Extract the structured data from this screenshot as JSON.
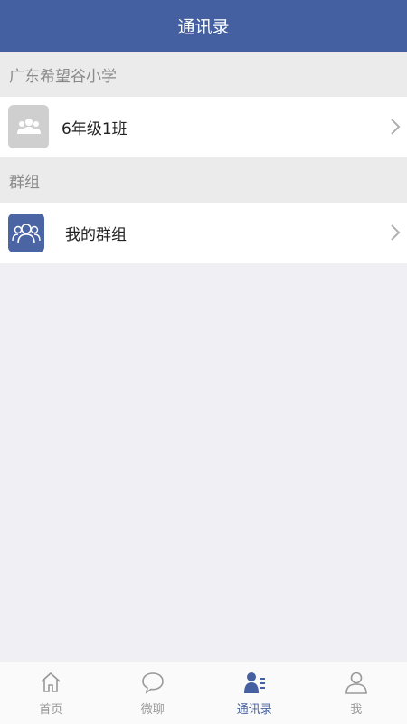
{
  "header": {
    "title": "通讯录"
  },
  "sections": [
    {
      "label": "广东希望谷小学",
      "row_label": "6年级1班"
    },
    {
      "label": "群组",
      "row_label": "我的群组"
    }
  ],
  "tabs": [
    {
      "label": "首页",
      "icon": "home-icon"
    },
    {
      "label": "微聊",
      "icon": "chat-bubble-icon"
    },
    {
      "label": "通讯录",
      "icon": "contacts-icon",
      "active": true
    },
    {
      "label": "我",
      "icon": "person-icon"
    }
  ],
  "colors": {
    "accent": "#4460a0",
    "section_bg": "#ebebeb",
    "page_bg": "#efeff4"
  }
}
